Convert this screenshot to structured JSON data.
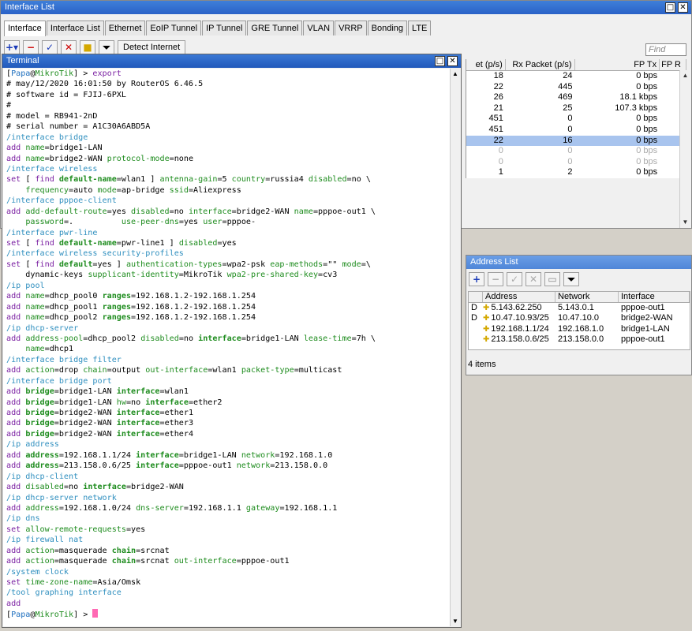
{
  "interface_window": {
    "title": "Interface List",
    "tabs": [
      "Interface",
      "Interface List",
      "Ethernet",
      "EoIP Tunnel",
      "IP Tunnel",
      "GRE Tunnel",
      "VLAN",
      "VRRP",
      "Bonding",
      "LTE"
    ],
    "active_tab": "Interface",
    "detect_button": "Detect Internet",
    "find_placeholder": "Find",
    "columns": [
      "et (p/s)",
      "Rx Packet (p/s)",
      "FP Tx",
      "FP R"
    ],
    "rows": [
      {
        "c1": "18",
        "c2": "24",
        "c3": "0 bps",
        "state": "normal"
      },
      {
        "c1": "22",
        "c2": "445",
        "c3": "0 bps",
        "state": "normal"
      },
      {
        "c1": "26",
        "c2": "469",
        "c3": "18.1 kbps",
        "state": "normal"
      },
      {
        "c1": "21",
        "c2": "25",
        "c3": "107.3 kbps",
        "state": "normal"
      },
      {
        "c1": "451",
        "c2": "0",
        "c3": "0 bps",
        "state": "normal"
      },
      {
        "c1": "451",
        "c2": "0",
        "c3": "0 bps",
        "state": "normal"
      },
      {
        "c1": "22",
        "c2": "16",
        "c3": "0 bps",
        "state": "selected"
      },
      {
        "c1": "0",
        "c2": "0",
        "c3": "0 bps",
        "state": "disabled"
      },
      {
        "c1": "0",
        "c2": "0",
        "c3": "0 bps",
        "state": "disabled"
      },
      {
        "c1": "1",
        "c2": "2",
        "c3": "0 bps",
        "state": "normal"
      }
    ]
  },
  "address_window": {
    "title": "Address List",
    "columns": [
      "Address",
      "Network",
      "Interface"
    ],
    "rows": [
      {
        "flag": "D",
        "address": "5.143.62.250",
        "network": "5.143.0.1",
        "interface": "pppoe-out1"
      },
      {
        "flag": "D",
        "address": "10.47.10.93/25",
        "network": "10.47.10.0",
        "interface": "bridge2-WAN"
      },
      {
        "flag": "",
        "address": "192.168.1.1/24",
        "network": "192.168.1.0",
        "interface": "bridge1-LAN"
      },
      {
        "flag": "",
        "address": "213.158.0.6/25",
        "network": "213.158.0.0",
        "interface": "pppoe-out1"
      }
    ],
    "status": "4 items"
  },
  "terminal": {
    "title": "Terminal",
    "lines": [
      [
        [
          "prompt",
          "["
        ],
        [
          "user",
          "Papa"
        ],
        [
          "prompt",
          "@"
        ],
        [
          "host",
          "MikroTik"
        ],
        [
          "prompt",
          "] > "
        ],
        [
          "cmdtxt",
          "export"
        ]
      ],
      [
        [
          "comment",
          "# may/12/2020 16:01:50 by RouterOS 6.46.5"
        ]
      ],
      [
        [
          "comment",
          "# software id = FJIJ-6PXL"
        ]
      ],
      [
        [
          "comment",
          "#"
        ]
      ],
      [
        [
          "comment",
          "# model = RB941-2nD"
        ]
      ],
      [
        [
          "comment",
          "# serial number = A1C30A6ABD5A"
        ]
      ],
      [
        [
          "cmd",
          "/interface bridge"
        ]
      ],
      [
        [
          "key",
          "add "
        ],
        [
          "prop",
          "name"
        ],
        [
          "val",
          "=bridge1-LAN"
        ]
      ],
      [
        [
          "key",
          "add "
        ],
        [
          "prop",
          "name"
        ],
        [
          "val",
          "=bridge2-WAN "
        ],
        [
          "prop",
          "protocol-mode"
        ],
        [
          "val",
          "=none"
        ]
      ],
      [
        [
          "cmd",
          "/interface wireless"
        ]
      ],
      [
        [
          "key",
          "set "
        ],
        [
          "val",
          "[ "
        ],
        [
          "key",
          "find "
        ],
        [
          "bold",
          "default-name"
        ],
        [
          "val",
          "=wlan1 ] "
        ],
        [
          "prop",
          "antenna-gain"
        ],
        [
          "val",
          "=5 "
        ],
        [
          "prop",
          "country"
        ],
        [
          "val",
          "=russia4 "
        ],
        [
          "prop",
          "disabled"
        ],
        [
          "val",
          "=no \\"
        ]
      ],
      [
        [
          "val",
          "    "
        ],
        [
          "prop",
          "frequency"
        ],
        [
          "val",
          "=auto "
        ],
        [
          "prop",
          "mode"
        ],
        [
          "val",
          "=ap-bridge "
        ],
        [
          "prop",
          "ssid"
        ],
        [
          "val",
          "=Aliexpress"
        ]
      ],
      [
        [
          "cmd",
          "/interface pppoe-client"
        ]
      ],
      [
        [
          "key",
          "add "
        ],
        [
          "prop",
          "add-default-route"
        ],
        [
          "val",
          "=yes "
        ],
        [
          "prop",
          "disabled"
        ],
        [
          "val",
          "=no "
        ],
        [
          "prop",
          "interface"
        ],
        [
          "val",
          "=bridge2-WAN "
        ],
        [
          "prop",
          "name"
        ],
        [
          "val",
          "=pppoe-out1 \\"
        ]
      ],
      [
        [
          "val",
          "    "
        ],
        [
          "prop",
          "password"
        ],
        [
          "val",
          "=.          "
        ],
        [
          "prop",
          "use-peer-dns"
        ],
        [
          "val",
          "=yes "
        ],
        [
          "prop",
          "user"
        ],
        [
          "val",
          "=pppoe-"
        ]
      ],
      [
        [
          "cmd",
          "/interface pwr-line"
        ]
      ],
      [
        [
          "key",
          "set "
        ],
        [
          "val",
          "[ "
        ],
        [
          "key",
          "find "
        ],
        [
          "bold",
          "default-name"
        ],
        [
          "val",
          "=pwr-line1 ] "
        ],
        [
          "prop",
          "disabled"
        ],
        [
          "val",
          "=yes"
        ]
      ],
      [
        [
          "cmd",
          "/interface wireless security-profiles"
        ]
      ],
      [
        [
          "key",
          "set "
        ],
        [
          "val",
          "[ "
        ],
        [
          "key",
          "find "
        ],
        [
          "bold",
          "default"
        ],
        [
          "val",
          "=yes ] "
        ],
        [
          "prop",
          "authentication-types"
        ],
        [
          "val",
          "=wpa2-psk "
        ],
        [
          "prop",
          "eap-methods"
        ],
        [
          "val",
          "=\"\" "
        ],
        [
          "prop",
          "mode"
        ],
        [
          "val",
          "=\\"
        ]
      ],
      [
        [
          "val",
          "    dynamic-keys "
        ],
        [
          "prop",
          "supplicant-identity"
        ],
        [
          "val",
          "=MikroTik "
        ],
        [
          "prop",
          "wpa2-pre-shared-key"
        ],
        [
          "val",
          "=cv3"
        ]
      ],
      [
        [
          "cmd",
          "/ip pool"
        ]
      ],
      [
        [
          "key",
          "add "
        ],
        [
          "prop",
          "name"
        ],
        [
          "val",
          "=dhcp_pool0 "
        ],
        [
          "bold",
          "ranges"
        ],
        [
          "val",
          "=192.168.1.2-192.168.1.254"
        ]
      ],
      [
        [
          "key",
          "add "
        ],
        [
          "prop",
          "name"
        ],
        [
          "val",
          "=dhcp_pool1 "
        ],
        [
          "bold",
          "ranges"
        ],
        [
          "val",
          "=192.168.1.2-192.168.1.254"
        ]
      ],
      [
        [
          "key",
          "add "
        ],
        [
          "prop",
          "name"
        ],
        [
          "val",
          "=dhcp_pool2 "
        ],
        [
          "bold",
          "ranges"
        ],
        [
          "val",
          "=192.168.1.2-192.168.1.254"
        ]
      ],
      [
        [
          "cmd",
          "/ip dhcp-server"
        ]
      ],
      [
        [
          "key",
          "add "
        ],
        [
          "prop",
          "address-pool"
        ],
        [
          "val",
          "=dhcp_pool2 "
        ],
        [
          "prop",
          "disabled"
        ],
        [
          "val",
          "=no "
        ],
        [
          "bold",
          "interface"
        ],
        [
          "val",
          "=bridge1-LAN "
        ],
        [
          "prop",
          "lease-time"
        ],
        [
          "val",
          "=7h \\"
        ]
      ],
      [
        [
          "val",
          "    "
        ],
        [
          "prop",
          "name"
        ],
        [
          "val",
          "=dhcp1"
        ]
      ],
      [
        [
          "cmd",
          "/interface bridge filter"
        ]
      ],
      [
        [
          "key",
          "add "
        ],
        [
          "prop",
          "action"
        ],
        [
          "val",
          "=drop "
        ],
        [
          "prop",
          "chain"
        ],
        [
          "val",
          "=output "
        ],
        [
          "prop",
          "out-interface"
        ],
        [
          "val",
          "=wlan1 "
        ],
        [
          "prop",
          "packet-type"
        ],
        [
          "val",
          "=multicast"
        ]
      ],
      [
        [
          "cmd",
          "/interface bridge port"
        ]
      ],
      [
        [
          "key",
          "add "
        ],
        [
          "bold",
          "bridge"
        ],
        [
          "val",
          "=bridge1-LAN "
        ],
        [
          "bold",
          "interface"
        ],
        [
          "val",
          "=wlan1"
        ]
      ],
      [
        [
          "key",
          "add "
        ],
        [
          "bold",
          "bridge"
        ],
        [
          "val",
          "=bridge1-LAN "
        ],
        [
          "prop",
          "hw"
        ],
        [
          "val",
          "=no "
        ],
        [
          "bold",
          "interface"
        ],
        [
          "val",
          "=ether2"
        ]
      ],
      [
        [
          "key",
          "add "
        ],
        [
          "bold",
          "bridge"
        ],
        [
          "val",
          "=bridge2-WAN "
        ],
        [
          "bold",
          "interface"
        ],
        [
          "val",
          "=ether1"
        ]
      ],
      [
        [
          "key",
          "add "
        ],
        [
          "bold",
          "bridge"
        ],
        [
          "val",
          "=bridge2-WAN "
        ],
        [
          "bold",
          "interface"
        ],
        [
          "val",
          "=ether3"
        ]
      ],
      [
        [
          "key",
          "add "
        ],
        [
          "bold",
          "bridge"
        ],
        [
          "val",
          "=bridge2-WAN "
        ],
        [
          "bold",
          "interface"
        ],
        [
          "val",
          "=ether4"
        ]
      ],
      [
        [
          "cmd",
          "/ip address"
        ]
      ],
      [
        [
          "key",
          "add "
        ],
        [
          "bold",
          "address"
        ],
        [
          "val",
          "=192.168.1.1/24 "
        ],
        [
          "bold",
          "interface"
        ],
        [
          "val",
          "=bridge1-LAN "
        ],
        [
          "prop",
          "network"
        ],
        [
          "val",
          "=192.168.1.0"
        ]
      ],
      [
        [
          "key",
          "add "
        ],
        [
          "bold",
          "address"
        ],
        [
          "val",
          "=213.158.0.6/25 "
        ],
        [
          "bold",
          "interface"
        ],
        [
          "val",
          "=pppoe-out1 "
        ],
        [
          "prop",
          "network"
        ],
        [
          "val",
          "=213.158.0.0"
        ]
      ],
      [
        [
          "cmd",
          "/ip dhcp-client"
        ]
      ],
      [
        [
          "key",
          "add "
        ],
        [
          "prop",
          "disabled"
        ],
        [
          "val",
          "=no "
        ],
        [
          "bold",
          "interface"
        ],
        [
          "val",
          "=bridge2-WAN"
        ]
      ],
      [
        [
          "cmd",
          "/ip dhcp-server network"
        ]
      ],
      [
        [
          "key",
          "add "
        ],
        [
          "prop",
          "address"
        ],
        [
          "val",
          "=192.168.1.0/24 "
        ],
        [
          "prop",
          "dns-server"
        ],
        [
          "val",
          "=192.168.1.1 "
        ],
        [
          "prop",
          "gateway"
        ],
        [
          "val",
          "=192.168.1.1"
        ]
      ],
      [
        [
          "cmd",
          "/ip dns"
        ]
      ],
      [
        [
          "key",
          "set "
        ],
        [
          "prop",
          "allow-remote-requests"
        ],
        [
          "val",
          "=yes"
        ]
      ],
      [
        [
          "cmd",
          "/ip firewall nat"
        ]
      ],
      [
        [
          "key",
          "add "
        ],
        [
          "prop",
          "action"
        ],
        [
          "val",
          "=masquerade "
        ],
        [
          "bold",
          "chain"
        ],
        [
          "val",
          "=srcnat"
        ]
      ],
      [
        [
          "key",
          "add "
        ],
        [
          "prop",
          "action"
        ],
        [
          "val",
          "=masquerade "
        ],
        [
          "bold",
          "chain"
        ],
        [
          "val",
          "=srcnat "
        ],
        [
          "prop",
          "out-interface"
        ],
        [
          "val",
          "=pppoe-out1"
        ]
      ],
      [
        [
          "cmd",
          "/system clock"
        ]
      ],
      [
        [
          "key",
          "set "
        ],
        [
          "prop",
          "time-zone-name"
        ],
        [
          "val",
          "=Asia/Omsk"
        ]
      ],
      [
        [
          "cmd",
          "/tool graphing interface"
        ]
      ],
      [
        [
          "key",
          "add"
        ]
      ],
      [
        [
          "prompt",
          "["
        ],
        [
          "user",
          "Papa"
        ],
        [
          "prompt",
          "@"
        ],
        [
          "host",
          "MikroTik"
        ],
        [
          "prompt",
          "] > "
        ],
        [
          "cursor",
          ""
        ]
      ]
    ]
  }
}
